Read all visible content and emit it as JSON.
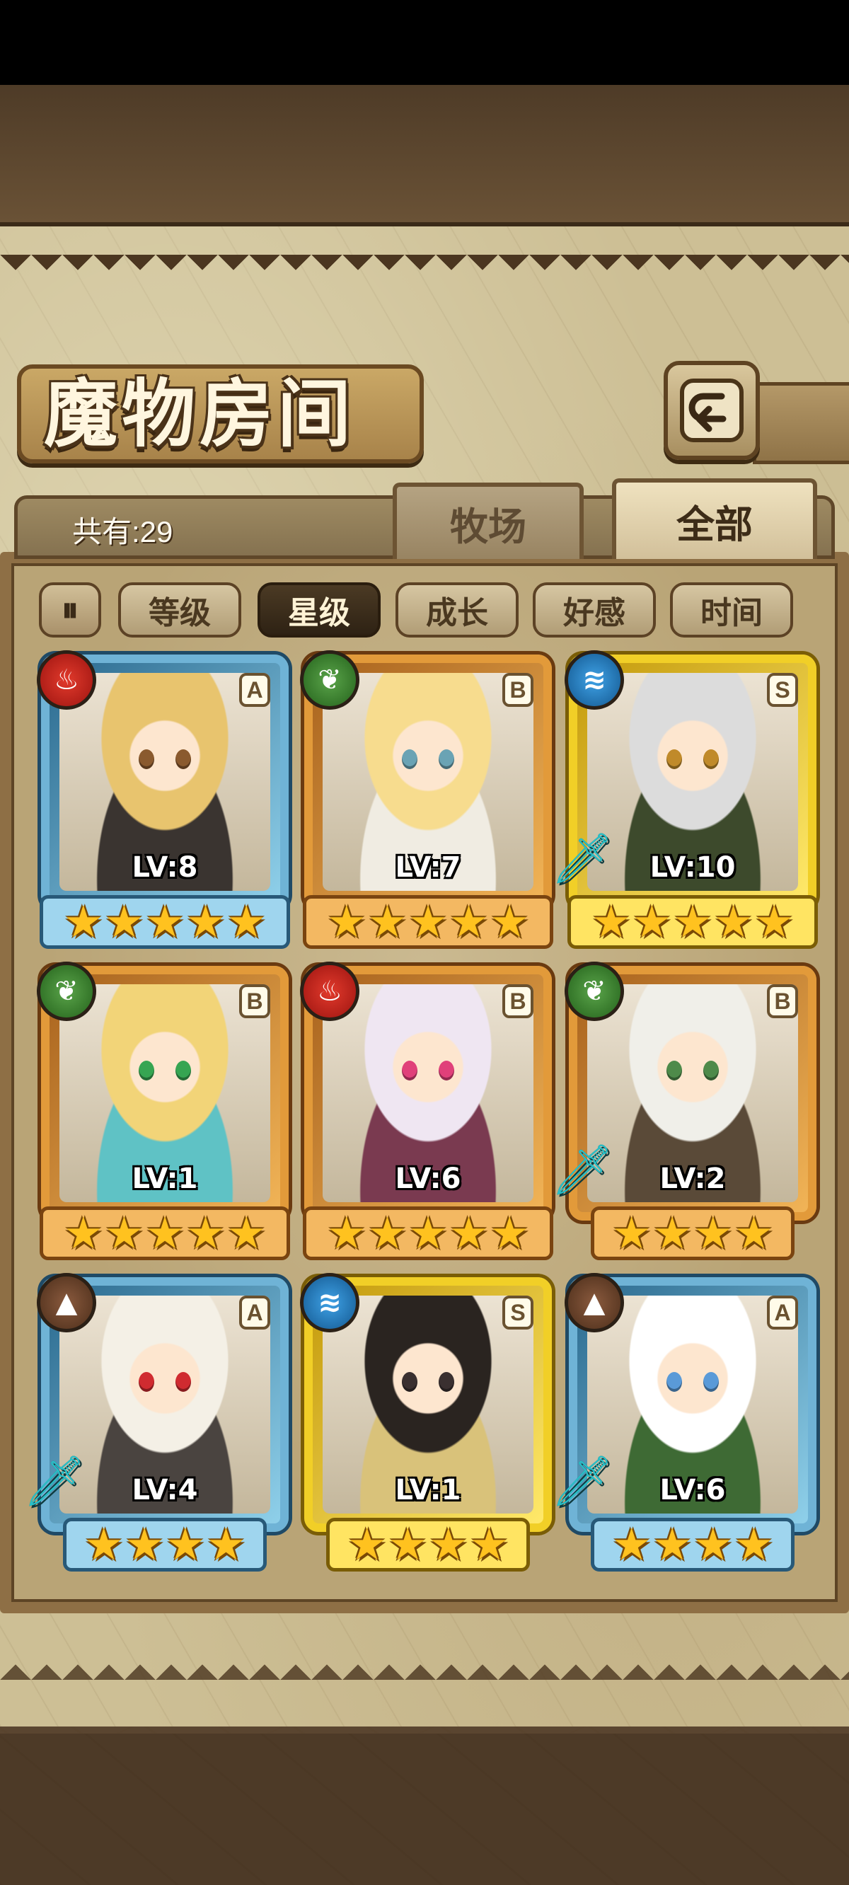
{
  "title": "魔物房间",
  "header": {
    "back_icon": "back-arrow-icon",
    "total_count": "共有:29"
  },
  "tabs": [
    {
      "label": "牧场",
      "active": false
    },
    {
      "label": "全部",
      "active": true
    }
  ],
  "sort_toggle": {
    "icon": "sort-toggle-icon",
    "glyph": "⏸"
  },
  "filters": [
    {
      "label": "等级",
      "active": false
    },
    {
      "label": "星级",
      "active": true
    },
    {
      "label": "成长",
      "active": false
    },
    {
      "label": "好感",
      "active": false
    },
    {
      "label": "时间",
      "active": false
    }
  ],
  "colors": {
    "rarity_A": "#6fb3d6",
    "rarity_B": "#e29a3a",
    "rarity_S": "#f1cf27",
    "fire": "#e23a2c",
    "nature": "#5aa44a",
    "water": "#3fa2e6",
    "earth": "#8a5a3e"
  },
  "monsters": [
    {
      "element": "fire",
      "element_glyph": "♨",
      "rarity": "A",
      "level": "LV:8",
      "stars": 5,
      "has_weapon": false,
      "hair": "#e8c46e",
      "cloth": "#3a3430",
      "eye": "#8a5a2e"
    },
    {
      "element": "nature",
      "element_glyph": "❦",
      "rarity": "B",
      "level": "LV:7",
      "stars": 5,
      "has_weapon": false,
      "hair": "#f7dc8e",
      "cloth": "#f0ece2",
      "eye": "#6aa3b4"
    },
    {
      "element": "water",
      "element_glyph": "≋",
      "rarity": "S",
      "level": "LV:10",
      "stars": 5,
      "has_weapon": true,
      "hair": "#dcdcdc",
      "cloth": "#3d4a2c",
      "eye": "#c08a2a"
    },
    {
      "element": "nature",
      "element_glyph": "❦",
      "rarity": "B",
      "level": "LV:1",
      "stars": 5,
      "has_weapon": false,
      "hair": "#f2d478",
      "cloth": "#5fc2c5",
      "eye": "#36a552"
    },
    {
      "element": "fire",
      "element_glyph": "♨",
      "rarity": "B",
      "level": "LV:6",
      "stars": 5,
      "has_weapon": false,
      "hair": "#efe6f2",
      "cloth": "#7a3a50",
      "eye": "#e0407a"
    },
    {
      "element": "nature",
      "element_glyph": "❦",
      "rarity": "B",
      "level": "LV:2",
      "stars": 4,
      "has_weapon": true,
      "hair": "#f0efe9",
      "cloth": "#5a4a38",
      "eye": "#4e8a4a"
    },
    {
      "element": "earth",
      "element_glyph": "▲",
      "rarity": "A",
      "level": "LV:4",
      "stars": 4,
      "has_weapon": true,
      "hair": "#f4f0e6",
      "cloth": "#4a4440",
      "eye": "#d02b30"
    },
    {
      "element": "water",
      "element_glyph": "≋",
      "rarity": "S",
      "level": "LV:1",
      "stars": 4,
      "has_weapon": false,
      "hair": "#2a2420",
      "cloth": "#d9c27a",
      "eye": "#3a3030"
    },
    {
      "element": "earth",
      "element_glyph": "▲",
      "rarity": "A",
      "level": "LV:6",
      "stars": 4,
      "has_weapon": true,
      "hair": "#ffffff",
      "cloth": "#3e6a34",
      "eye": "#5a9ad8"
    }
  ]
}
